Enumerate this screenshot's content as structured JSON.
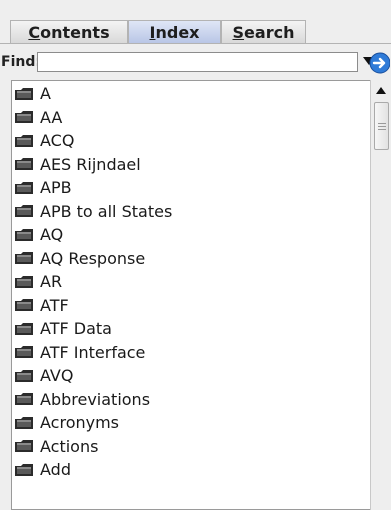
{
  "tabs": [
    {
      "prefix": "",
      "underline": "C",
      "suffix": "ontents"
    },
    {
      "prefix": "",
      "underline": "I",
      "suffix": "ndex"
    },
    {
      "prefix": "",
      "underline": "S",
      "suffix": "earch"
    }
  ],
  "active_tab_index": 1,
  "find": {
    "label": "Find:",
    "value": ""
  },
  "icons": {
    "dropdown": "chevron-down-icon",
    "go": "arrow-right-circle-icon",
    "folder": "folder-icon"
  },
  "colors": {
    "active_tab": "#c0cbea",
    "go_button": "#2f7bd8"
  },
  "index_items": [
    "A",
    "AA",
    "ACQ",
    "AES Rijndael",
    "APB",
    "APB to all States",
    "AQ",
    "AQ Response",
    "AR",
    "ATF",
    "ATF Data",
    "ATF Interface",
    "AVQ",
    "Abbreviations",
    "Acronyms",
    "Actions",
    "Add"
  ]
}
